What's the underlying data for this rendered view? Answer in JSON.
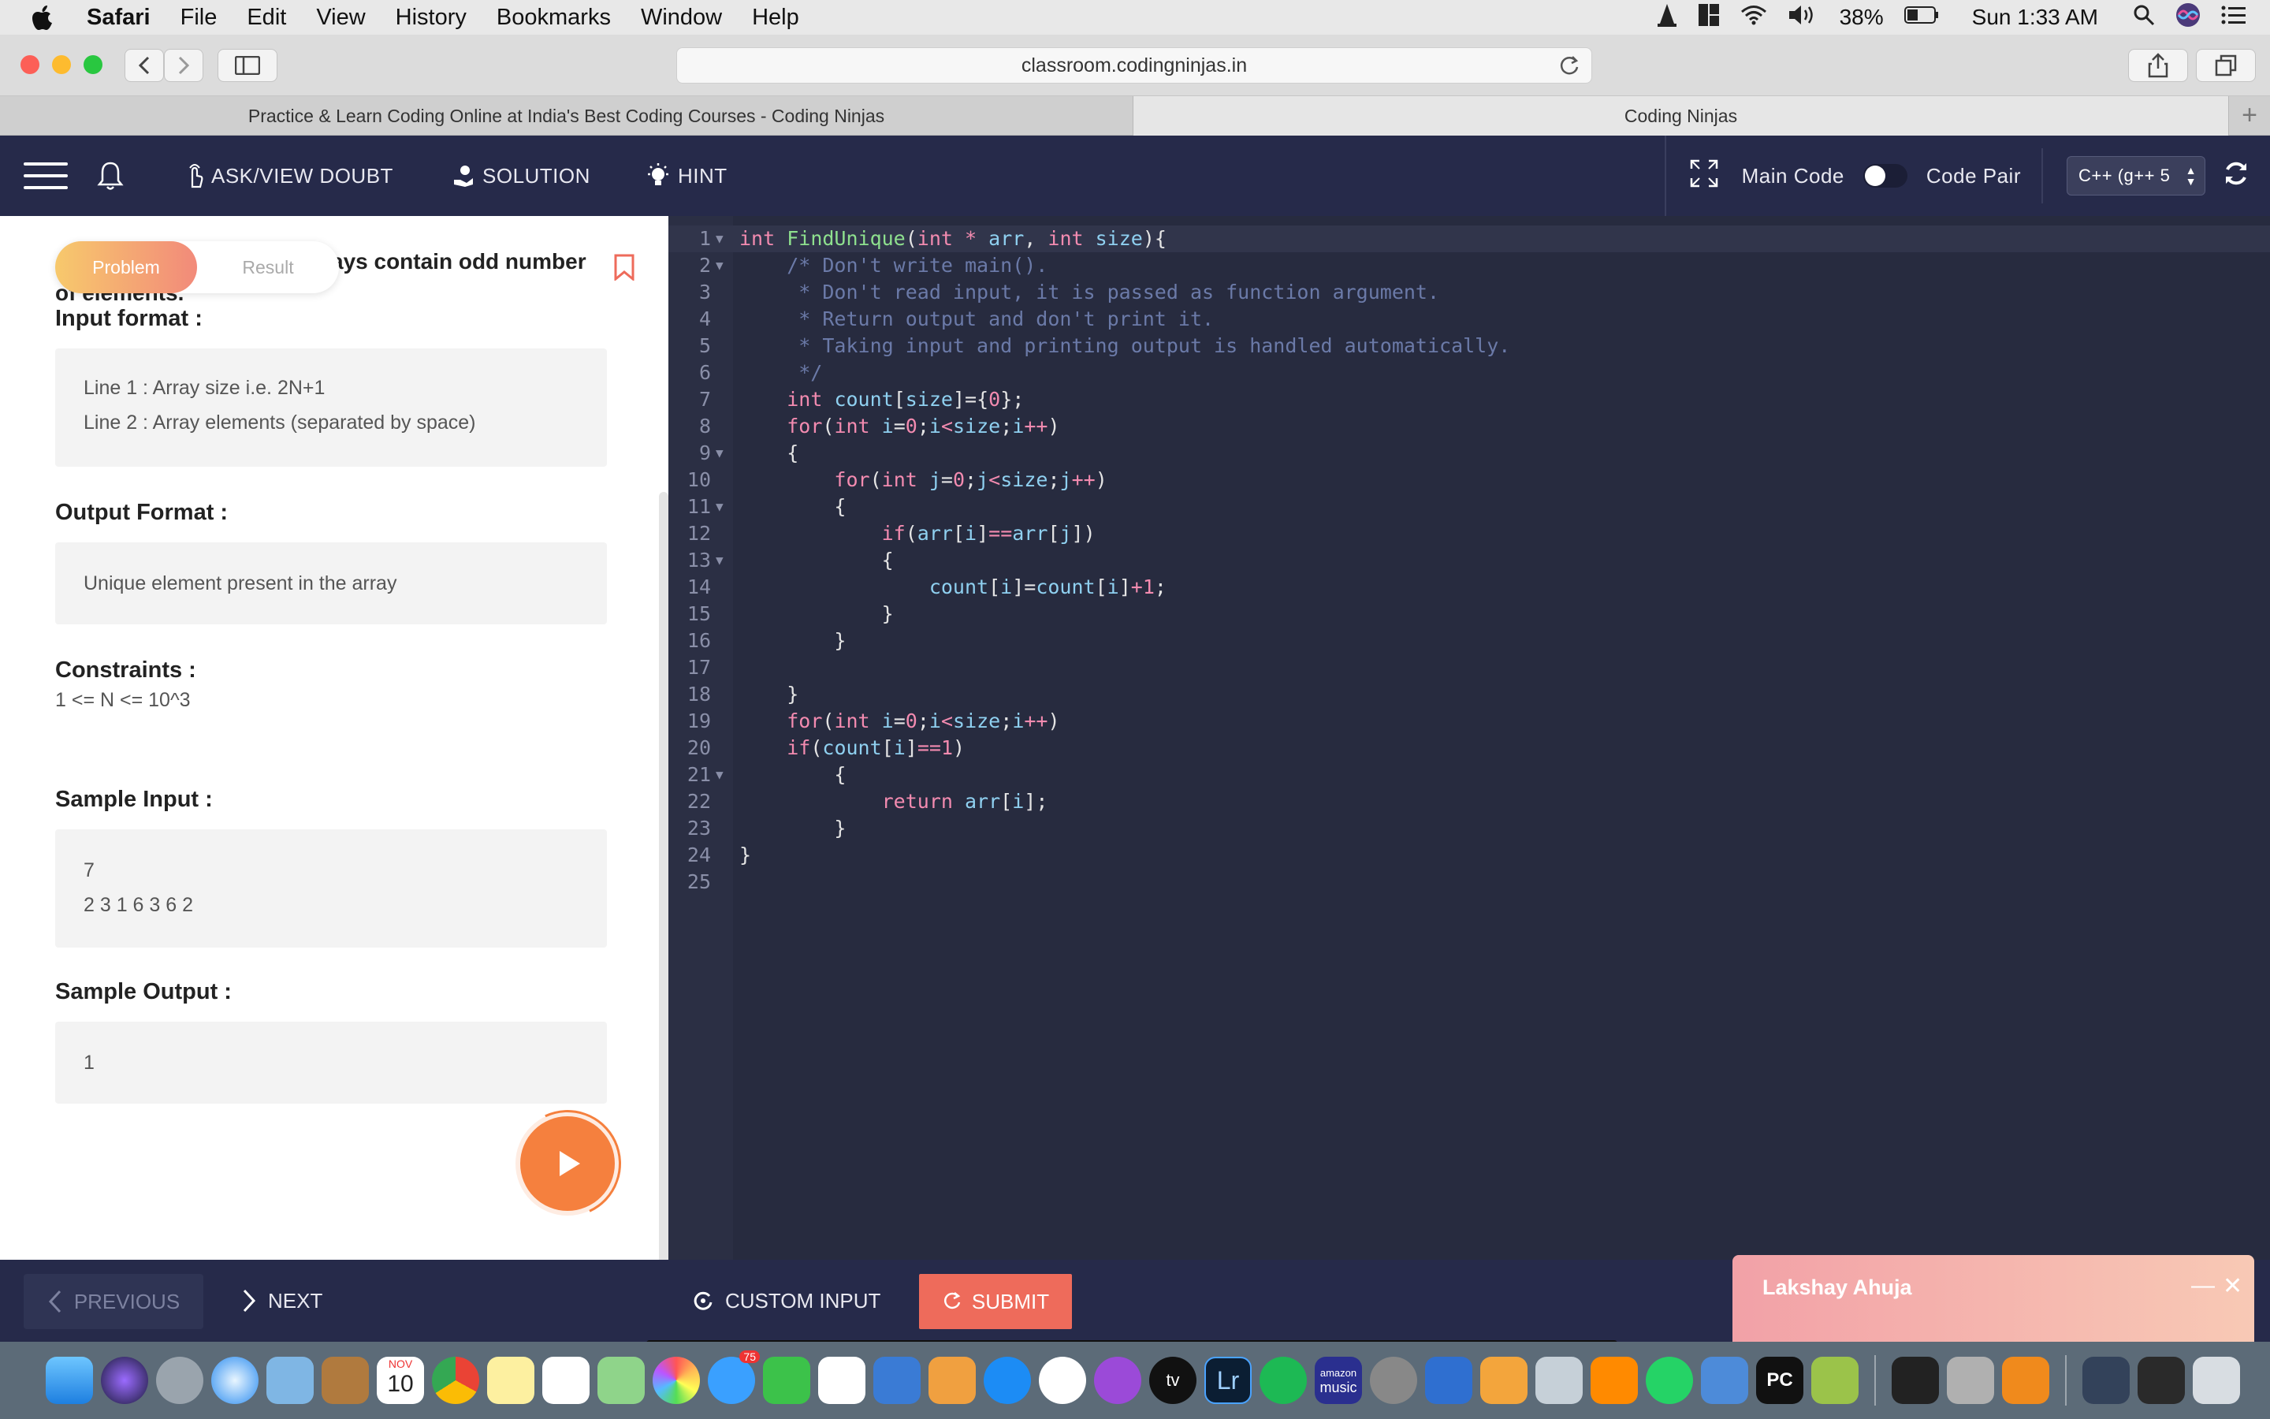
{
  "menubar": {
    "app_name": "Safari",
    "items": [
      "File",
      "Edit",
      "View",
      "History",
      "Bookmarks",
      "Window",
      "Help"
    ],
    "battery": "38%",
    "clock": "Sun 1:33 AM"
  },
  "browser": {
    "url": "classroom.codingninjas.in",
    "tabs": [
      {
        "title": "Practice & Learn Coding Online at India's Best Coding Courses - Coding Ninjas",
        "active": false
      },
      {
        "title": "Coding Ninjas",
        "active": true
      }
    ]
  },
  "header": {
    "ask_doubt": "ASK/VIEW DOUBT",
    "solution": "SOLUTION",
    "hint": "HINT",
    "main_code": "Main Code",
    "code_pair": "Code Pair",
    "language": "C++ (g++ 5"
  },
  "problem": {
    "tab_problem": "Problem",
    "tab_result": "Result",
    "title_fragment": "ays contain odd number",
    "title_fragment2": "of elements.",
    "input_format_heading": "Input format :",
    "input_format_lines": [
      "Line 1 : Array size i.e. 2N+1",
      "Line 2 : Array elements (separated by space)"
    ],
    "output_format_heading": "Output Format :",
    "output_format_text": "Unique element present in the array",
    "constraints_heading": "Constraints :",
    "constraints_text": "1 <= N <= 10^3",
    "sample_input_heading": "Sample Input :",
    "sample_input_lines": [
      "7",
      "2 3 1 6 3 6 2"
    ],
    "sample_output_heading": "Sample Output :",
    "sample_output_text": "1"
  },
  "code_lines": [
    {
      "n": "1",
      "fold": true,
      "html": "<span style='color:#f38bb0'>int</span> <span style='color:#8ee08e'>FindUnique</span>(<span style='color:#f38bb0'>int</span> <span style='color:#f38bb0'>*</span> <span style='color:#8fd0f0'>arr</span>, <span style='color:#f38bb0'>int</span> <span style='color:#8fd0f0'>size</span>){"
    },
    {
      "n": "2",
      "fold": true,
      "html": "    <span style='color:#6b7aa8'>/* Don't write main().</span>"
    },
    {
      "n": "3",
      "fold": false,
      "html": "<span style='color:#6b7aa8'>     * Don't read input, it is passed as function argument.</span>"
    },
    {
      "n": "4",
      "fold": false,
      "html": "<span style='color:#6b7aa8'>     * Return output and don't print it.</span>"
    },
    {
      "n": "5",
      "fold": false,
      "html": "<span style='color:#6b7aa8'>     * Taking input and printing output is handled automatically.</span>"
    },
    {
      "n": "6",
      "fold": false,
      "html": "<span style='color:#6b7aa8'>     */</span>"
    },
    {
      "n": "7",
      "fold": false,
      "html": "    <span style='color:#f38bb0'>int</span> <span style='color:#8fd0f0'>count</span>[<span style='color:#8fd0f0'>size</span>]=<span>{</span><span style='color:#f38bb0'>0</span>};"
    },
    {
      "n": "8",
      "fold": false,
      "html": "    <span style='color:#f38bb0'>for</span>(<span style='color:#f38bb0'>int</span> <span style='color:#8fd0f0'>i</span>=<span style='color:#f38bb0'>0</span>;<span style='color:#8fd0f0'>i</span><span style='color:#f38bb0'>&lt;</span><span style='color:#8fd0f0'>size</span>;<span style='color:#8fd0f0'>i</span><span style='color:#f38bb0'>++</span>)"
    },
    {
      "n": "9",
      "fold": true,
      "html": "    {"
    },
    {
      "n": "10",
      "fold": false,
      "html": "        <span style='color:#f38bb0'>for</span>(<span style='color:#f38bb0'>int</span> <span style='color:#8fd0f0'>j</span>=<span style='color:#f38bb0'>0</span>;<span style='color:#8fd0f0'>j</span><span style='color:#f38bb0'>&lt;</span><span style='color:#8fd0f0'>size</span>;<span style='color:#8fd0f0'>j</span><span style='color:#f38bb0'>++</span>)"
    },
    {
      "n": "11",
      "fold": true,
      "html": "        {"
    },
    {
      "n": "12",
      "fold": false,
      "html": "            <span style='color:#f38bb0'>if</span>(<span style='color:#8fd0f0'>arr</span>[<span style='color:#8fd0f0'>i</span>]<span style='color:#f38bb0'>==</span><span style='color:#8fd0f0'>arr</span>[<span style='color:#8fd0f0'>j</span>])"
    },
    {
      "n": "13",
      "fold": true,
      "html": "            {"
    },
    {
      "n": "14",
      "fold": false,
      "html": "                <span style='color:#8fd0f0'>count</span>[<span style='color:#8fd0f0'>i</span>]=<span style='color:#8fd0f0'>count</span>[<span style='color:#8fd0f0'>i</span>]<span style='color:#f38bb0'>+1</span>;"
    },
    {
      "n": "15",
      "fold": false,
      "html": "            }"
    },
    {
      "n": "16",
      "fold": false,
      "html": "        }"
    },
    {
      "n": "17",
      "fold": false,
      "html": ""
    },
    {
      "n": "18",
      "fold": false,
      "html": "    }"
    },
    {
      "n": "19",
      "fold": false,
      "html": "    <span style='color:#f38bb0'>for</span>(<span style='color:#f38bb0'>int</span> <span style='color:#8fd0f0'>i</span>=<span style='color:#f38bb0'>0</span>;<span style='color:#8fd0f0'>i</span><span style='color:#f38bb0'>&lt;</span><span style='color:#8fd0f0'>size</span>;<span style='color:#8fd0f0'>i</span><span style='color:#f38bb0'>++</span>)"
    },
    {
      "n": "20",
      "fold": false,
      "html": "    <span style='color:#f38bb0'>if</span>(<span style='color:#8fd0f0'>count</span>[<span style='color:#8fd0f0'>i</span>]<span style='color:#f38bb0'>==1</span>)"
    },
    {
      "n": "21",
      "fold": true,
      "html": "        {"
    },
    {
      "n": "22",
      "fold": false,
      "html": "            <span style='color:#f38bb0'>return</span> <span style='color:#8fd0f0'>arr</span>[<span style='color:#8fd0f0'>i</span>];"
    },
    {
      "n": "23",
      "fold": false,
      "html": "        }"
    },
    {
      "n": "24",
      "fold": false,
      "html": "}"
    },
    {
      "n": "25",
      "fold": false,
      "html": ""
    }
  ],
  "footer": {
    "previous": "PREVIOUS",
    "next": "NEXT",
    "custom_input": "CUSTOM INPUT",
    "submit": "SUBMIT"
  },
  "chat": {
    "name": "Lakshay Ahuja"
  },
  "dock": {
    "calendar_month": "NOV",
    "calendar_day": "10",
    "messages_badge": "75",
    "lightroom": "Lr",
    "appletv": "tv",
    "amazon_music_1": "amazon",
    "amazon_music_2": "music",
    "pycharm": "PC"
  },
  "colors": {
    "header_bg": "#262a4a",
    "editor_bg": "#272b3f",
    "accent_orange": "#f5803e",
    "submit": "#ee6b5b"
  }
}
